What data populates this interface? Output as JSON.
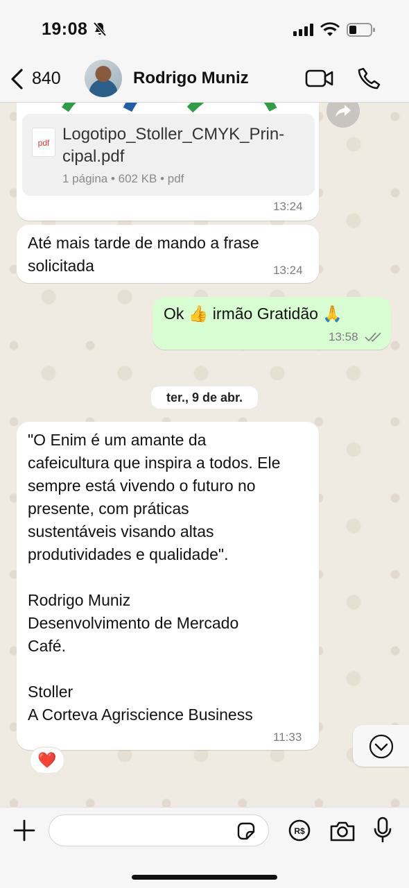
{
  "status_bar": {
    "time": "19:08"
  },
  "header": {
    "back_count": "840",
    "contact_name": "Rodrigo Muniz"
  },
  "messages": {
    "file": {
      "file_name": "Logotipo_Stoller_CMYK_Prin-\ncipal.pdf",
      "meta": "1 página • 602 KB • pdf",
      "time": "13:24"
    },
    "msg1": {
      "text": "Até mais tarde de mando a frase\nsolicitada",
      "time": "13:24"
    },
    "msg2": {
      "text": "Ok 👍 irmão Gratidão 🙏",
      "time": "13:58",
      "status": "read"
    },
    "date_separator": "ter., 9 de abr.",
    "msg3": {
      "text": "\"O Enim é um amante da\ncafeicultura que inspira a todos. Ele\nsempre está vivendo o futuro no\npresente, com práticas\nsustentáveis visando altas\nprodutividades e qualidade\".\n\nRodrigo Muniz\nDesenvolvimento de Mercado\nCafé.\n\nStoller\nA Corteva Agriscience Business",
      "time": "11:33",
      "reaction": "❤️"
    }
  },
  "colors": {
    "outgoing_bubble": "#d9fdd3",
    "incoming_bubble": "#ffffff",
    "chat_bg": "#efeae2",
    "accent_blue": "#007aff"
  }
}
